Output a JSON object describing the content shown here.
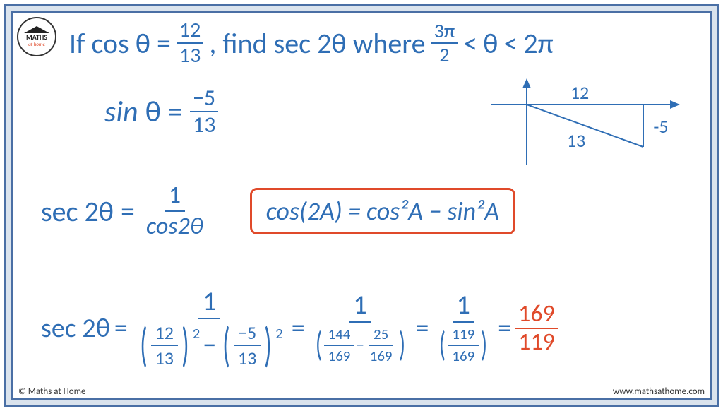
{
  "logo": {
    "brand": "MATHS",
    "sub": "at home"
  },
  "problem": {
    "prefix": "If cos θ =",
    "given_num": "12",
    "given_den": "13",
    "mid": ", find sec 2θ  where",
    "range_num": "3π",
    "range_den": "2",
    "range_lt1": "<",
    "range_var": "θ",
    "range_lt2": "<",
    "range_end": "2π"
  },
  "sin": {
    "label": "sin",
    "var": "θ",
    "eq": "=",
    "num": "−5",
    "den": "13"
  },
  "diagram": {
    "adjacent": "12",
    "opposite": "-5",
    "hypotenuse": "13"
  },
  "secdef": {
    "lhs": "sec 2θ",
    "eq": "=",
    "num": "1",
    "den": "cos2θ"
  },
  "identity": "cos(2A) = cos²A − sin²A",
  "calc": {
    "lhs": "sec 2θ",
    "eq": "=",
    "one": "1",
    "a_num": "12",
    "a_den": "13",
    "minus": "−",
    "b_num": "−5",
    "b_den": "13",
    "sq": "2",
    "eq2": "=",
    "c1_num": "144",
    "c1_den": "169",
    "c2_num": "25",
    "c2_den": "169",
    "eq3": "=",
    "d_num": "119",
    "d_den": "169",
    "eq4": "=",
    "ans_num": "169",
    "ans_den": "119"
  },
  "footer": {
    "left": "© Maths at Home",
    "right": "www.mathsathome.com"
  }
}
